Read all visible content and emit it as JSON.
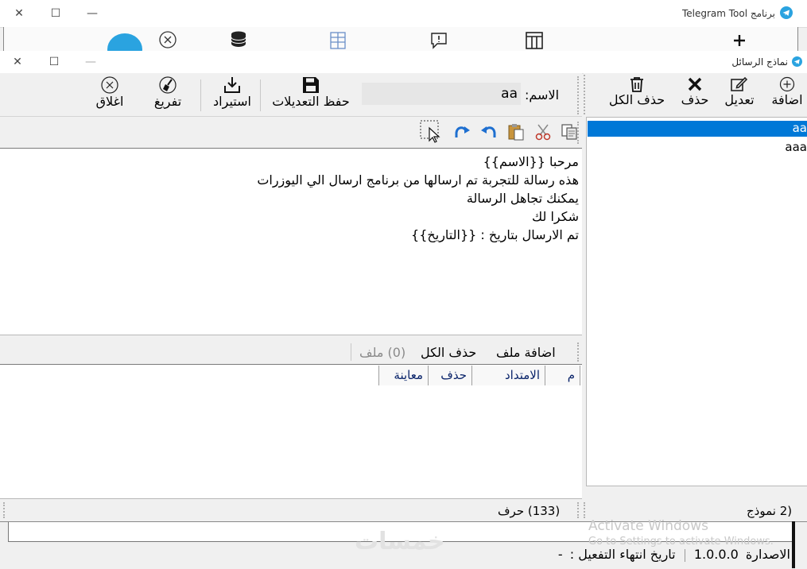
{
  "outer_window": {
    "title": "برنامج Telegram Tool",
    "activation_notice_title": "Activate Windows",
    "activation_notice_hint": "Go to Settings to activate Windows.",
    "watermark": "خمسات"
  },
  "dialog": {
    "title": "نماذج الرسائل",
    "list_toolbar": {
      "add": "اضافة",
      "edit": "تعديل",
      "delete": "حذف",
      "delete_all": "حذف الكل"
    },
    "template_list": [
      "aa",
      "aaa"
    ],
    "name_label": "الاسم:",
    "name_value": "aa",
    "main_toolbar": {
      "save": "حفظ التعديلات",
      "import": "استيراد",
      "clear": "تفريغ",
      "close": "اغلاق"
    },
    "message_lines": [
      "مرحبا {{الاسم}}",
      "هذه رسالة للتجربة تم ارسالها من برنامج ارسال الي اليوزرات",
      "يمكنك تجاهل الرسالة",
      "شكرا لك",
      "تم الارسال بتاريخ : {{التاريخ}}"
    ],
    "attachments_bar": {
      "add_file": "اضافة ملف",
      "delete_all": "حذف الكل",
      "file_count": "(0) ملف"
    },
    "attachments_table_headers": [
      "م",
      "الامتداد",
      "حذف",
      "معاينة"
    ],
    "status": {
      "chars": "(133) حرف",
      "templates": "(2 نموذج"
    }
  },
  "footer": {
    "version_label": "الاصدارة",
    "version_value": "1.0.0.0",
    "expiry_label": "تاريخ انتهاء التفعيل :",
    "expiry_value": "-"
  },
  "colors": {
    "selection": "#0078d7",
    "telegram": "#2aa3e0",
    "header_text": "#0a246a",
    "undo_blue": "#1e6fd0"
  }
}
